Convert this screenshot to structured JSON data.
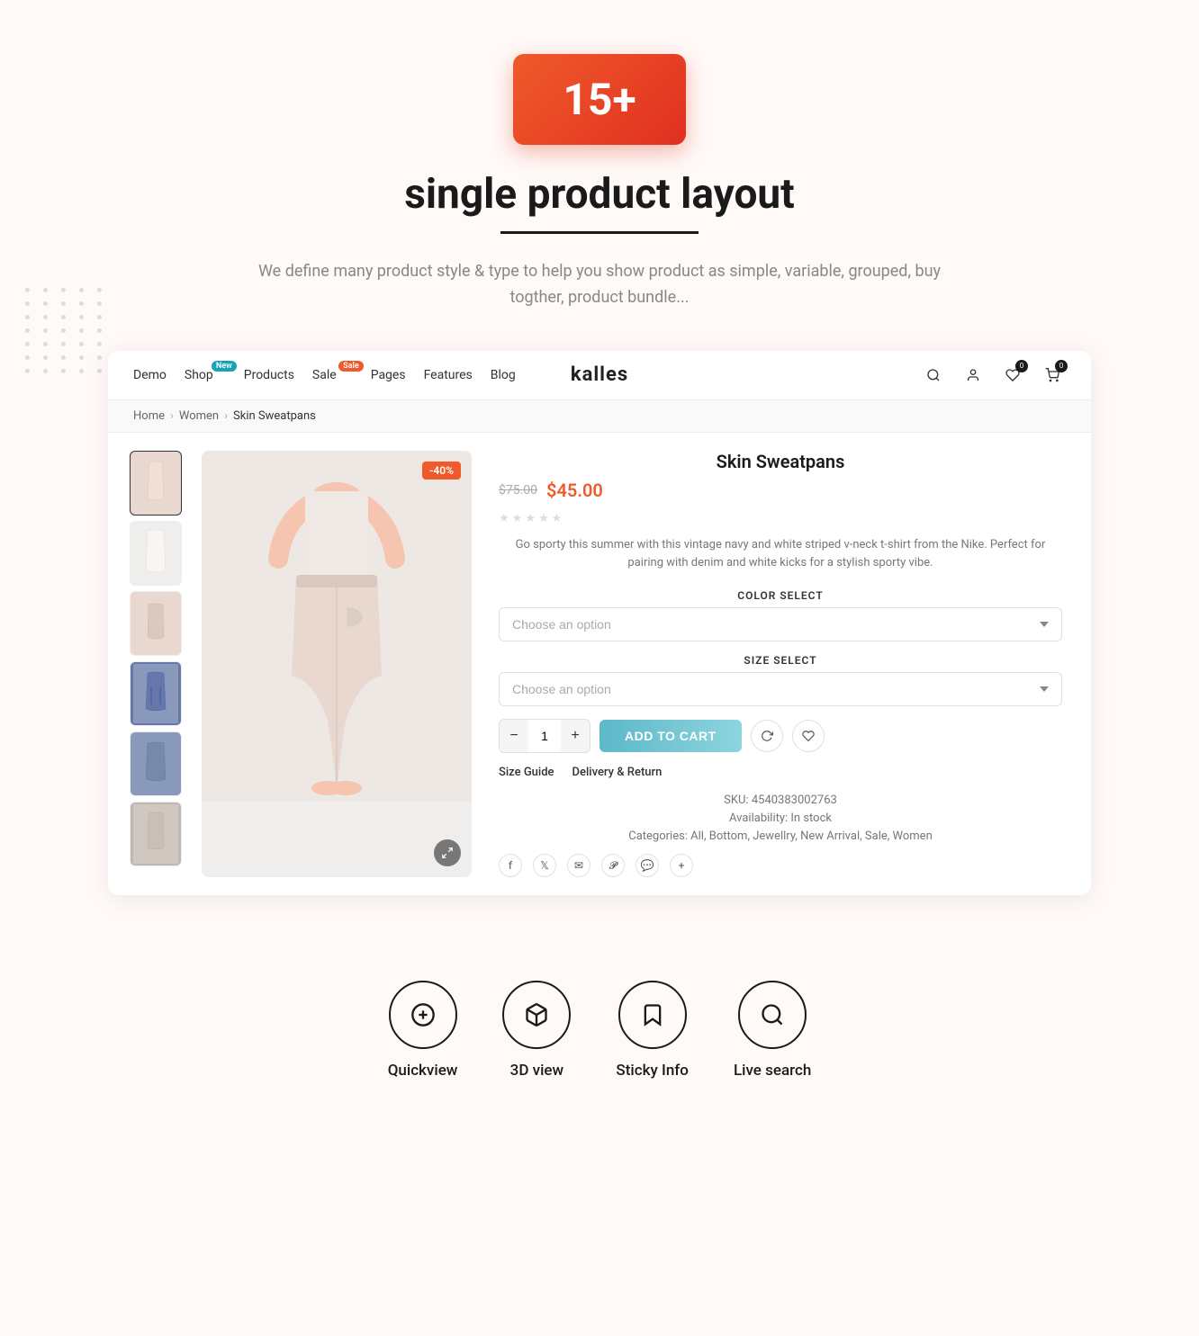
{
  "hero": {
    "badge": "15+",
    "title": "single product layout",
    "description": "We define many product style & type to help you show product as simple, variable, grouped, buy togther, product bundle..."
  },
  "navbar": {
    "links": [
      {
        "label": "Demo",
        "badge": null
      },
      {
        "label": "Shop",
        "badge": "New"
      },
      {
        "label": "Products",
        "badge": null
      },
      {
        "label": "Sale",
        "badge": "Sale"
      },
      {
        "label": "Pages",
        "badge": null
      },
      {
        "label": "Features",
        "badge": null
      },
      {
        "label": "Blog",
        "badge": null
      }
    ],
    "brand": "kalles",
    "wishlist_count": "0",
    "cart_count": "0"
  },
  "breadcrumb": {
    "home": "Home",
    "category": "Women",
    "product": "Skin Sweatpans"
  },
  "product": {
    "name": "Skin Sweatpans",
    "price_old": "$75.00",
    "price_new": "$45.00",
    "discount": "-40%",
    "description": "Go sporty this summer with this vintage navy and white striped v-neck t-shirt from the Nike. Perfect for pairing with denim and white kicks for a stylish sporty vibe.",
    "color_label": "COLOR SELECT",
    "color_placeholder": "Choose an option",
    "size_label": "SIZE SELECT",
    "size_placeholder": "Choose an option",
    "qty": "1",
    "add_to_cart": "ADD TO CART",
    "size_guide": "Size Guide",
    "delivery_return": "Delivery & Return",
    "sku": "SKU: 4540383002763",
    "availability": "Availability: In stock",
    "categories": "Categories: All, Bottom, Jewellry, New Arrival, Sale, Women"
  },
  "features": [
    {
      "icon": "➕",
      "label": "Quickview",
      "name": "quickview"
    },
    {
      "icon": "📦",
      "label": "3D view",
      "name": "3d-view"
    },
    {
      "icon": "🔖",
      "label": "Sticky Info",
      "name": "sticky-info"
    },
    {
      "icon": "🔍",
      "label": "Live search",
      "name": "live-search"
    }
  ],
  "thumbnails": [
    {
      "color": "thumb-pink"
    },
    {
      "color": "thumb-white"
    },
    {
      "color": "thumb-pink"
    },
    {
      "color": "thumb-denim"
    },
    {
      "color": "thumb-blue"
    },
    {
      "color": "thumb-gray"
    }
  ]
}
